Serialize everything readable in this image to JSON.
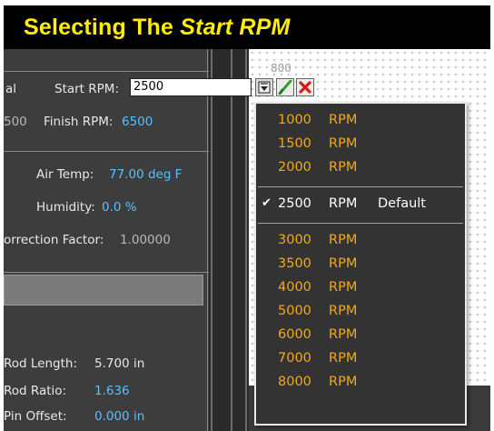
{
  "title": {
    "prefix": "Selecting The ",
    "emphasis": "Start RPM"
  },
  "panel": {
    "top_left_fragment": "al",
    "start_rpm_label": "Start RPM:",
    "start_rpm_value": "2500",
    "prev_value_fragment": "500",
    "finish_rpm_label": "Finish RPM:",
    "finish_rpm_value": "6500",
    "air_temp_label": "Air Temp:",
    "air_temp_value": "77.00 deg F",
    "humidity_label": "Humidity:",
    "humidity_value": "0.0 %",
    "correction_label": "orrection Factor:",
    "correction_value": "1.00000",
    "rod_length_label": "Rod Length:",
    "rod_length_value": "5.700 in",
    "rod_ratio_label": "Rod Ratio:",
    "rod_ratio_value": "1.636",
    "pin_offset_label": "Pin Offset:",
    "pin_offset_value": "0.000 in"
  },
  "graph": {
    "axis_top_label": "800"
  },
  "buttons": {
    "dropdown_icon": "dropdown-arrow-icon",
    "accept_icon": "green-check-icon",
    "cancel_icon": "red-x-icon"
  },
  "dropdown": {
    "unit": "RPM",
    "groups": [
      [
        {
          "value": "1000"
        },
        {
          "value": "1500"
        },
        {
          "value": "2000"
        }
      ],
      [
        {
          "value": "2500",
          "selected": true,
          "note": "Default"
        }
      ],
      [
        {
          "value": "3000"
        },
        {
          "value": "3500"
        },
        {
          "value": "4000"
        },
        {
          "value": "5000"
        },
        {
          "value": "6000"
        },
        {
          "value": "7000"
        },
        {
          "value": "8000"
        }
      ]
    ]
  },
  "colors": {
    "title_yellow": "#ffee00",
    "option_orange": "#f2a81c",
    "value_blue": "#56c0ff"
  }
}
